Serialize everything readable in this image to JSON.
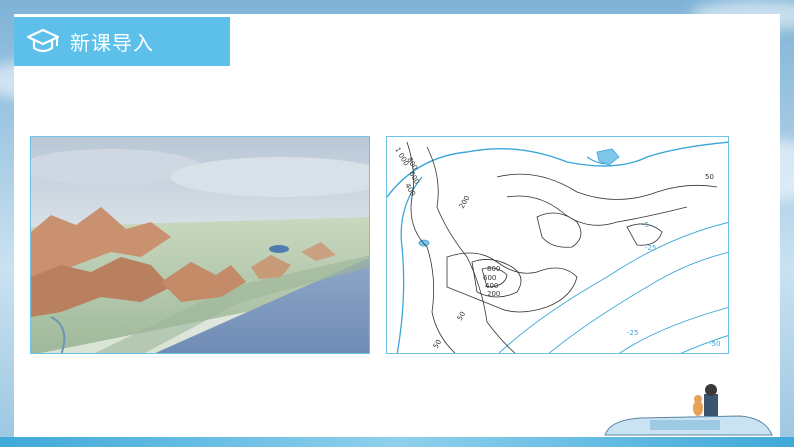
{
  "banner": {
    "title": "新课导入",
    "icon": "graduation-cap-icon"
  },
  "contour_map": {
    "land_labels": [
      "1 000",
      "800",
      "600",
      "400",
      "200",
      "800",
      "600",
      "400",
      "200",
      "50",
      "50",
      "50"
    ],
    "sea_labels": [
      "-5",
      "-25",
      "-25",
      "-50"
    ]
  },
  "colors": {
    "banner": "#5cc0ea",
    "panel_border": "#6ec3e8",
    "contour_land": "#333333",
    "contour_sea": "#3ba6d8"
  }
}
